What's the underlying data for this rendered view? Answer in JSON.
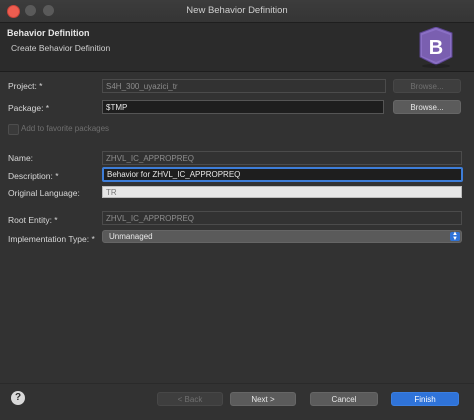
{
  "window": {
    "title": "New Behavior Definition"
  },
  "header": {
    "title": "Behavior Definition",
    "subtitle": "Create Behavior Definition",
    "logo_letter": "B"
  },
  "form": {
    "project": {
      "label": "Project: *",
      "value": "S4H_300_uyazici_tr",
      "browse": "Browse..."
    },
    "package": {
      "label": "Package: *",
      "value": "$TMP",
      "browse": "Browse..."
    },
    "favorites": {
      "label": "Add to favorite packages"
    },
    "name": {
      "label": "Name:",
      "value": "ZHVL_IC_APPROPREQ"
    },
    "description": {
      "label": "Description: *",
      "value": "Behavior for ZHVL_IC_APPROPREQ"
    },
    "original_language": {
      "label": "Original Language:",
      "value": "TR"
    },
    "root_entity": {
      "label": "Root Entity: *",
      "value": "ZHVL_IC_APPROPREQ"
    },
    "implementation_type": {
      "label": "Implementation Type: *",
      "value": "Unmanaged"
    }
  },
  "footer": {
    "help": "?",
    "back": "< Back",
    "next": "Next >",
    "cancel": "Cancel",
    "finish": "Finish"
  },
  "colors": {
    "accent": "#2f73d8",
    "close": "#ee5d50",
    "logo": "#7a5fb0"
  }
}
